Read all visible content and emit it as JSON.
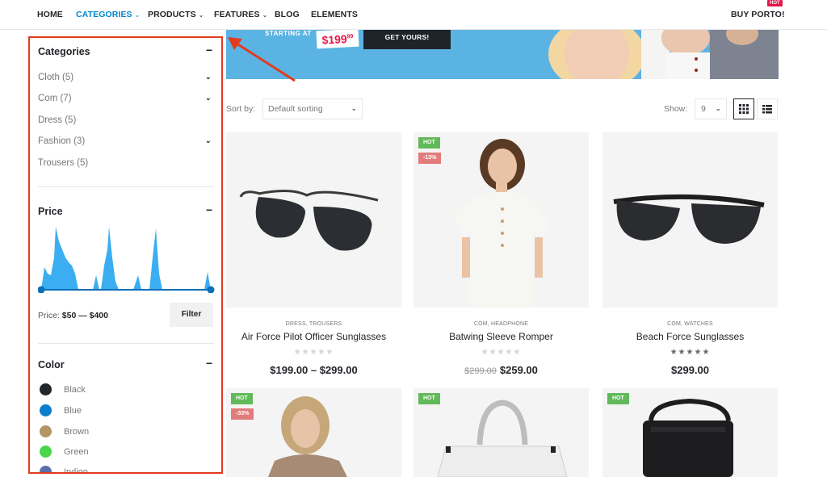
{
  "nav": {
    "items": [
      {
        "label": "HOME",
        "active": false,
        "dropdown": false
      },
      {
        "label": "CATEGORIES",
        "active": true,
        "dropdown": true
      },
      {
        "label": "PRODUCTS",
        "active": false,
        "dropdown": true
      },
      {
        "label": "FEATURES",
        "active": false,
        "dropdown": true
      },
      {
        "label": "BLOG",
        "active": false,
        "dropdown": false
      },
      {
        "label": "ELEMENTS",
        "active": false,
        "dropdown": false
      }
    ],
    "buy_label": "BUY PORTO!",
    "hot_tag": "HOT",
    "accent_color": "#0088cc"
  },
  "banner": {
    "starting_text": "STARTING AT",
    "price_main": "$199",
    "price_cents": "99",
    "cta_label": "GET YOURS!"
  },
  "sidebar": {
    "categories_title": "Categories",
    "categories": [
      {
        "label": "Cloth (5)",
        "expandable": true
      },
      {
        "label": "Com (7)",
        "expandable": true
      },
      {
        "label": "Dress (5)",
        "expandable": false
      },
      {
        "label": "Fashion (3)",
        "expandable": true
      },
      {
        "label": "Trousers (5)",
        "expandable": false
      }
    ],
    "price_title": "Price",
    "price_prefix": "Price:",
    "price_range": "$50 — $400",
    "filter_label": "Filter",
    "color_title": "Color",
    "colors": [
      {
        "name": "Black",
        "hex": "#222529"
      },
      {
        "name": "Blue",
        "hex": "#0b7fce"
      },
      {
        "name": "Brown",
        "hex": "#b49566"
      },
      {
        "name": "Green",
        "hex": "#4cd44a"
      },
      {
        "name": "Indigo",
        "hex": "#5c6fa8"
      }
    ],
    "toggle_symbol": "−",
    "highlight_color": "#e23b1f"
  },
  "toolbar": {
    "sort_label": "Sort by:",
    "sort_value": "Default sorting",
    "show_label": "Show:",
    "show_value": "9"
  },
  "products": [
    {
      "name": "Air Force Pilot Officer Sunglasses",
      "cats": "DRESS, TROUSERS",
      "price": "$199.00 – $299.00",
      "old_price": "",
      "rating": 0,
      "badges": []
    },
    {
      "name": "Batwing Sleeve Romper",
      "cats": "COM, HEADPHONE",
      "price": "$259.00",
      "old_price": "$299.00",
      "rating": 0,
      "badges": [
        "HOT",
        "-13%"
      ]
    },
    {
      "name": "Beach Force Sunglasses",
      "cats": "COM, WATCHES",
      "price": "$299.00",
      "old_price": "",
      "rating": 5,
      "badges": []
    },
    {
      "badges": [
        "HOT",
        "-33%"
      ]
    },
    {
      "badges": [
        "HOT"
      ]
    },
    {
      "badges": [
        "HOT"
      ]
    }
  ],
  "stars": "★★★★★"
}
